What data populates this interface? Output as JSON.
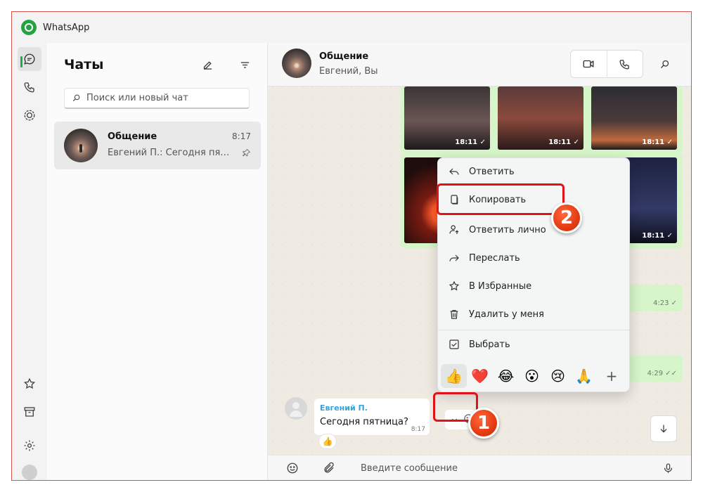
{
  "app": {
    "title": "WhatsApp"
  },
  "sidebar": {
    "title": "Чаты",
    "search_placeholder": "Поиск или новый чат",
    "chat_item": {
      "name": "Общение",
      "time": "8:17",
      "preview": "Евгений П.: Сегодня пятница?"
    }
  },
  "chat": {
    "name": "Общение",
    "participants": "Евгений, Вы",
    "photos_row1_times": [
      "18:11 ✓",
      "18:11 ✓",
      "18:11 ✓"
    ],
    "photos_row2_time": "18:11 ✓",
    "photos_row2_time_right": "18:11 ✓",
    "outgoing_times": [
      "4:23 ✓",
      "4:29 ✓✓"
    ],
    "incoming": {
      "sender": "Евгений П.",
      "text": "Сегодня пятница?",
      "time": "8:17",
      "reaction": "👍"
    },
    "composer_placeholder": "Введите сообщение"
  },
  "context_menu": {
    "items": [
      {
        "label": "Ответить",
        "icon": "reply-icon"
      },
      {
        "label": "Копировать",
        "icon": "copy-icon"
      },
      {
        "label": "Ответить лично",
        "icon": "reply-private-icon"
      },
      {
        "label": "Переслать",
        "icon": "forward-icon"
      },
      {
        "label": "В Избранные",
        "icon": "star-icon"
      },
      {
        "label": "Удалить у меня",
        "icon": "trash-icon"
      },
      {
        "label": "Выбрать",
        "icon": "checkbox-icon"
      }
    ],
    "emojis": [
      "👍",
      "❤️",
      "😂",
      "😮",
      "😢",
      "🙏"
    ],
    "more": "+"
  },
  "annotations": {
    "step1": "1",
    "step2": "2"
  },
  "colors": {
    "accent": "#1fa855",
    "highlight": "#e0121a",
    "outgoing_bubble": "#d6f5c8"
  }
}
